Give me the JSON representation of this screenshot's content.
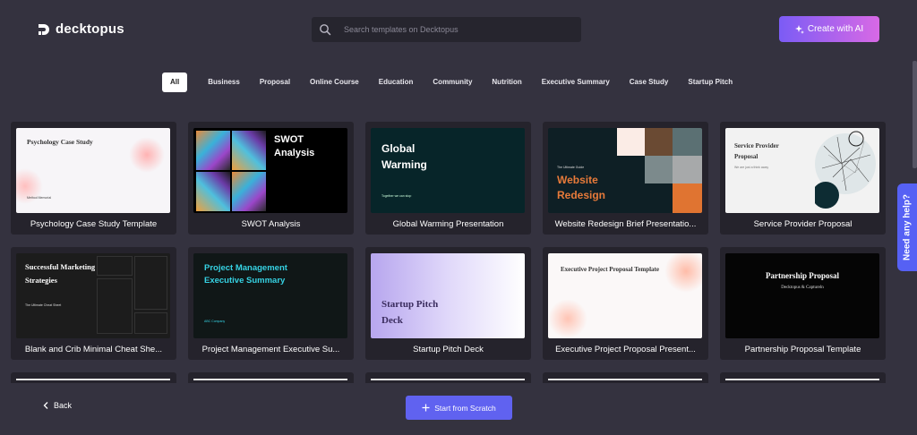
{
  "header": {
    "logo_text": "decktopus",
    "search_placeholder": "Search templates on Decktopus",
    "ai_button_label": "Create with AI"
  },
  "categories": [
    "All",
    "Business",
    "Proposal",
    "Online Course",
    "Education",
    "Community",
    "Nutrition",
    "Executive Summary",
    "Case Study",
    "Startup Pitch"
  ],
  "templates": [
    {
      "title": "Psychology Case Study Template",
      "thumb_text": "Psychology Case Study",
      "thumb_sub": "Method Memorial"
    },
    {
      "title": "SWOT Analysis",
      "thumb_text": "SWOT Analysis"
    },
    {
      "title": "Global Warming Presentation",
      "thumb_text": "Global Warming",
      "thumb_sub": "Together we can stop"
    },
    {
      "title": "Website Redesign Brief Presentatio...",
      "thumb_text": "Website Redesign",
      "thumb_sub": "The Ultimate Guide"
    },
    {
      "title": "Service Provider Proposal",
      "thumb_text": "Service Provider Proposal",
      "thumb_sub": "We are just a think away"
    },
    {
      "title": "Blank and Crib Minimal Cheat She...",
      "thumb_text": "Successful Marketing Strategies",
      "thumb_sub": "The Ultimate Cheat Sheet"
    },
    {
      "title": "Project Management Executive Su...",
      "thumb_text": "Project Management Executive Summary",
      "thumb_sub": "ABC Company"
    },
    {
      "title": "Startup Pitch Deck",
      "thumb_text": "Startup Pitch Deck"
    },
    {
      "title": "Executive Project Proposal Present...",
      "thumb_text": "Executive Project Proposal Template"
    },
    {
      "title": "Partnership Proposal Template",
      "thumb_text": "Partnership Proposal",
      "thumb_sub": "Decktopus & Captureln"
    }
  ],
  "footer": {
    "back_label": "Back",
    "scratch_label": "Start from Scratch"
  },
  "help": {
    "label": "Need any help?"
  },
  "colors": {
    "background": "#34323f",
    "card": "#25232c",
    "primary": "#6062f0",
    "ai_gradient_start": "#7b5cf5",
    "ai_gradient_end": "#d869e5"
  }
}
